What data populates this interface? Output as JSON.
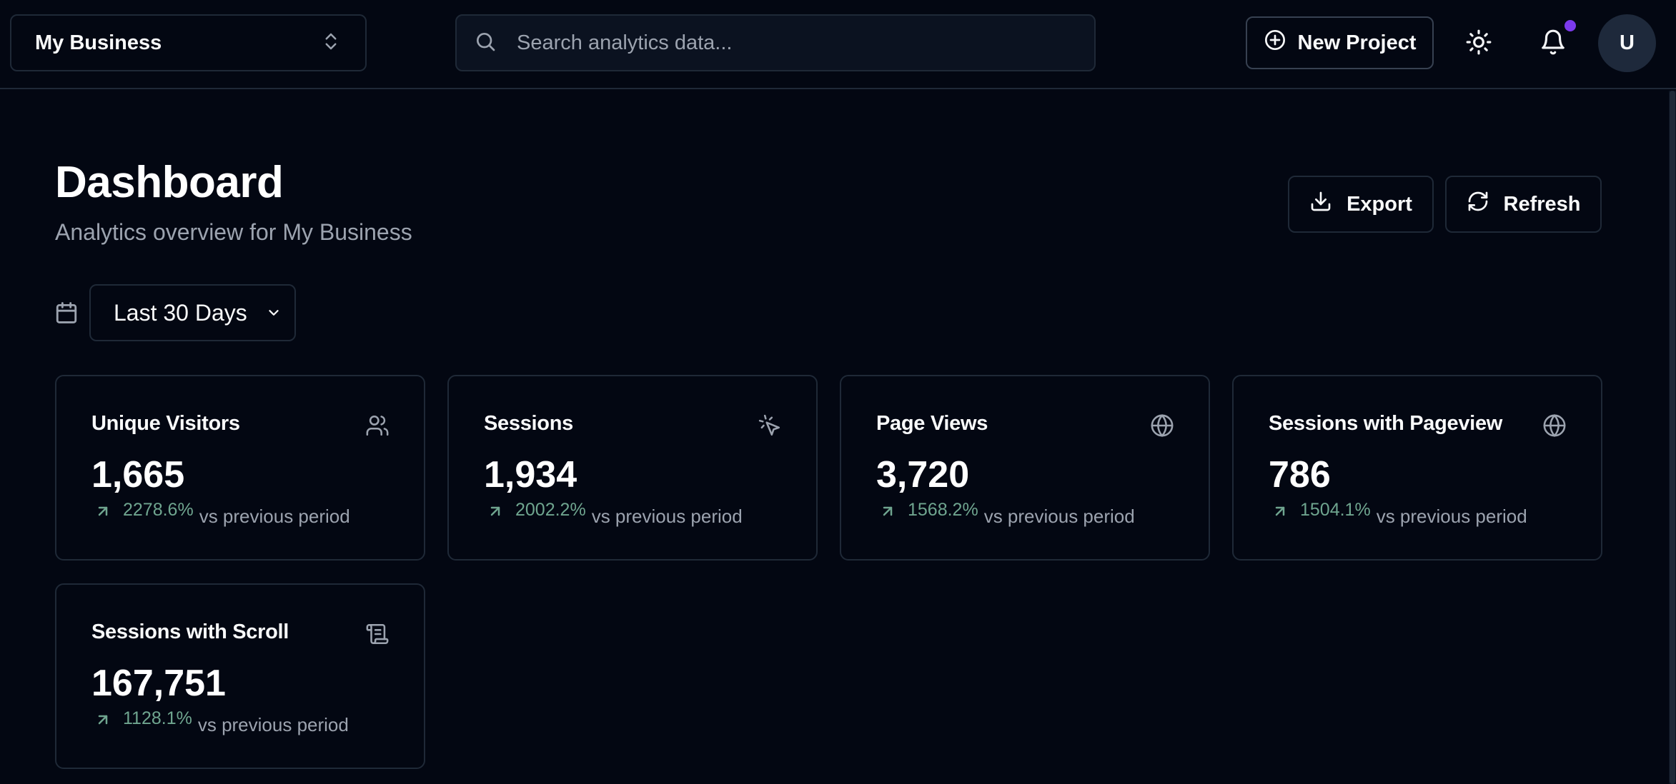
{
  "header": {
    "business_select": "My Business",
    "search_placeholder": "Search analytics data...",
    "new_project_label": "New Project",
    "avatar_initial": "U"
  },
  "page": {
    "title": "Dashboard",
    "subtitle": "Analytics overview for My Business",
    "export_label": "Export",
    "refresh_label": "Refresh",
    "date_range": "Last 30 Days"
  },
  "colors": {
    "background": "#030712",
    "border": "#1f2937",
    "positive_change": "#6fa58f",
    "notification_dot": "#7c3aed"
  },
  "metrics": [
    {
      "title": "Unique Visitors",
      "value": "1,665",
      "change": "2278.6%",
      "comparison": "vs previous period",
      "icon": "users-icon"
    },
    {
      "title": "Sessions",
      "value": "1,934",
      "change": "2002.2%",
      "comparison": "vs previous period",
      "icon": "mouse-pointer-click-icon"
    },
    {
      "title": "Page Views",
      "value": "3,720",
      "change": "1568.2%",
      "comparison": "vs previous period",
      "icon": "globe-icon"
    },
    {
      "title": "Sessions with Pageview",
      "value": "786",
      "change": "1504.1%",
      "comparison": "vs previous period",
      "icon": "globe-icon"
    },
    {
      "title": "Sessions with Scroll",
      "value": "167,751",
      "change": "1128.1%",
      "comparison": "vs previous period",
      "icon": "scroll-icon"
    }
  ]
}
